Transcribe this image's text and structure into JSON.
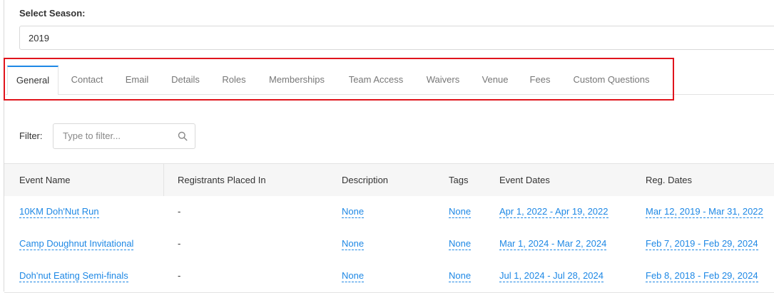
{
  "season": {
    "label": "Select Season:",
    "value": "2019"
  },
  "tabs": [
    {
      "label": "General",
      "active": true
    },
    {
      "label": "Contact"
    },
    {
      "label": "Email"
    },
    {
      "label": "Details"
    },
    {
      "label": "Roles"
    },
    {
      "label": "Memberships"
    },
    {
      "label": "Team Access"
    },
    {
      "label": "Waivers"
    },
    {
      "label": "Venue"
    },
    {
      "label": "Fees"
    },
    {
      "label": "Custom Questions"
    }
  ],
  "filter": {
    "label": "Filter:",
    "placeholder": "Type to filter..."
  },
  "table": {
    "headers": [
      "Event Name",
      "Registrants Placed In",
      "Description",
      "Tags",
      "Event Dates",
      "Reg. Dates"
    ],
    "rows": [
      {
        "name": "10KM Doh'Nut Run",
        "registrants": "-",
        "description": "None",
        "tags": "None",
        "event_dates": "Apr 1, 2022 - Apr 19, 2022",
        "reg_dates": "Mar 12, 2019 - Mar 31, 2022"
      },
      {
        "name": "Camp Doughnut Invitational",
        "registrants": "-",
        "description": "None",
        "tags": "None",
        "event_dates": "Mar 1, 2024 - Mar 2, 2024",
        "reg_dates": "Feb 7, 2019 - Feb 29, 2024"
      },
      {
        "name": "Doh'nut Eating Semi-finals",
        "registrants": "-",
        "description": "None",
        "tags": "None",
        "event_dates": "Jul 1, 2024 - Jul 28, 2024",
        "reg_dates": "Feb 8, 2018 - Feb 29, 2024"
      }
    ]
  },
  "colors": {
    "link": "#1e88e5",
    "active_tab_border": "#1e88e5",
    "highlight": "#e0141c"
  }
}
